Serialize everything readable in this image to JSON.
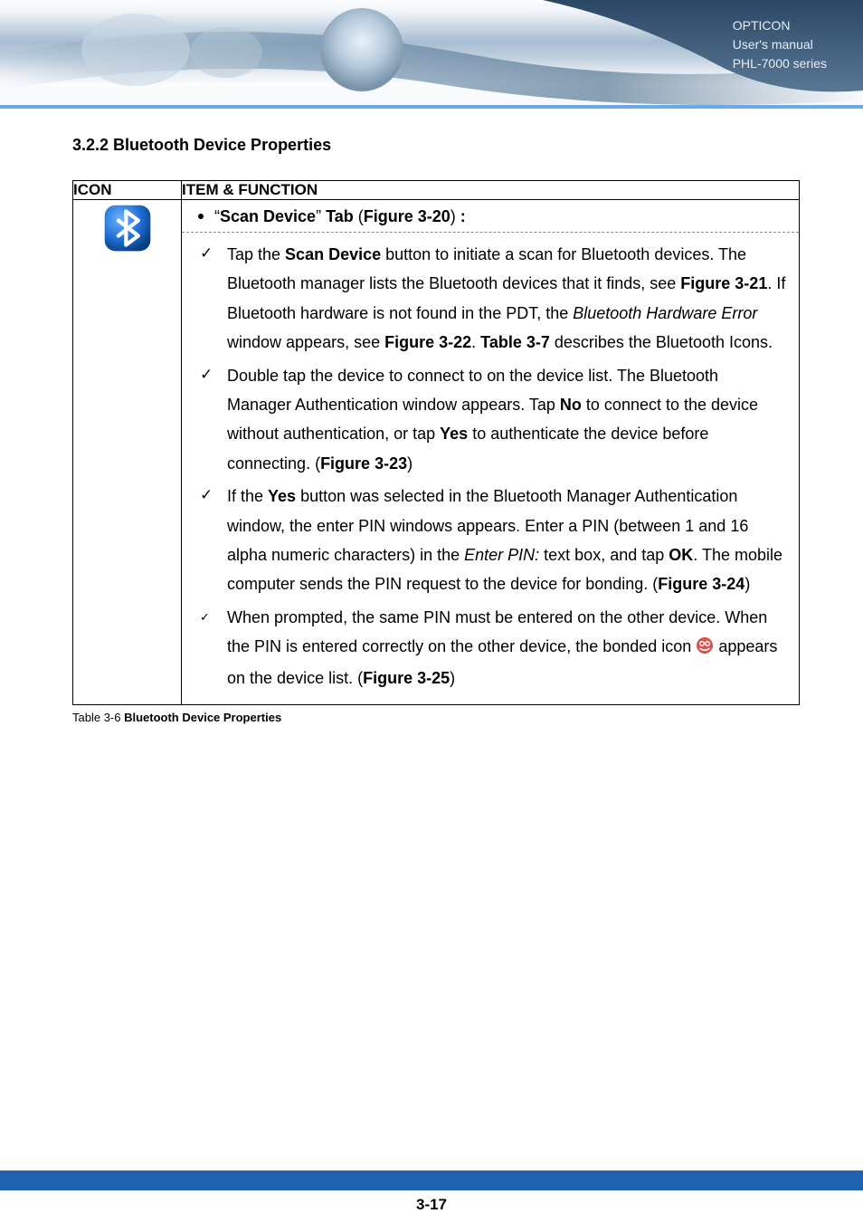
{
  "header": {
    "brand": "OPTICON",
    "line2": "User's manual",
    "line3": "PHL-7000 series"
  },
  "section": {
    "heading": "3.2.2 Bluetooth Device Properties"
  },
  "table": {
    "headers": {
      "icon": "ICON",
      "func": "ITEM & FUNCTION"
    },
    "tab_label_prefix": "“",
    "tab_label_bold1": "Scan Device",
    "tab_label_mid": "” ",
    "tab_label_bold2": "Tab",
    "tab_label_open": " (",
    "tab_label_bold3": "Figure 3-20",
    "tab_label_close": ") ",
    "tab_label_colon": ":",
    "items": [
      {
        "segments": [
          {
            "t": "Tap the "
          },
          {
            "t": "Scan Device",
            "b": true
          },
          {
            "t": " button to initiate a scan for Bluetooth devices. The Bluetooth manager lists the Bluetooth devices that it finds, see "
          },
          {
            "t": "Figure 3-21",
            "b": true
          },
          {
            "t": ". If Bluetooth hardware is not found in the PDT, the "
          },
          {
            "t": "Bluetooth Hardware Error",
            "i": true
          },
          {
            "t": " window appears, see "
          },
          {
            "t": "Figure 3-22",
            "b": true
          },
          {
            "t": ". "
          },
          {
            "t": "Table 3-7",
            "b": true
          },
          {
            "t": " describes the Bluetooth Icons."
          }
        ]
      },
      {
        "segments": [
          {
            "t": "Double tap the device to connect to on the device list. The Bluetooth Manager Authentication window appears. Tap "
          },
          {
            "t": "No",
            "b": true
          },
          {
            "t": " to connect to the device without authentication, or tap "
          },
          {
            "t": "Yes",
            "b": true
          },
          {
            "t": " to authenticate the device before connecting. ("
          },
          {
            "t": "Figure 3-23",
            "b": true
          },
          {
            "t": ")"
          }
        ]
      },
      {
        "segments": [
          {
            "t": "If the "
          },
          {
            "t": "Yes",
            "b": true
          },
          {
            "t": " button was selected in the Bluetooth Manager Authentication window, the enter PIN windows appears. Enter a PIN (between 1 and 16 alpha numeric characters) in the "
          },
          {
            "t": "Enter PIN:",
            "i": true
          },
          {
            "t": " text box, and tap "
          },
          {
            "t": "OK",
            "b": true
          },
          {
            "t": ". The mobile computer sends the PIN request to the device for bonding. ("
          },
          {
            "t": "Figure 3-24",
            "b": true
          },
          {
            "t": ")"
          }
        ]
      },
      {
        "small": true,
        "segments": [
          {
            "t": "When prompted, the same PIN must be entered on the other device. When the PIN is entered correctly on the other device, the bonded icon "
          },
          {
            "icon": "bonded"
          },
          {
            "t": " appears on the device list. ("
          },
          {
            "t": "Figure 3-25",
            "b": true
          },
          {
            "t": ")"
          }
        ]
      }
    ]
  },
  "caption": {
    "prefix": "Table 3-6 ",
    "bold": "Bluetooth Device Properties"
  },
  "footer": {
    "page": "3-17"
  }
}
